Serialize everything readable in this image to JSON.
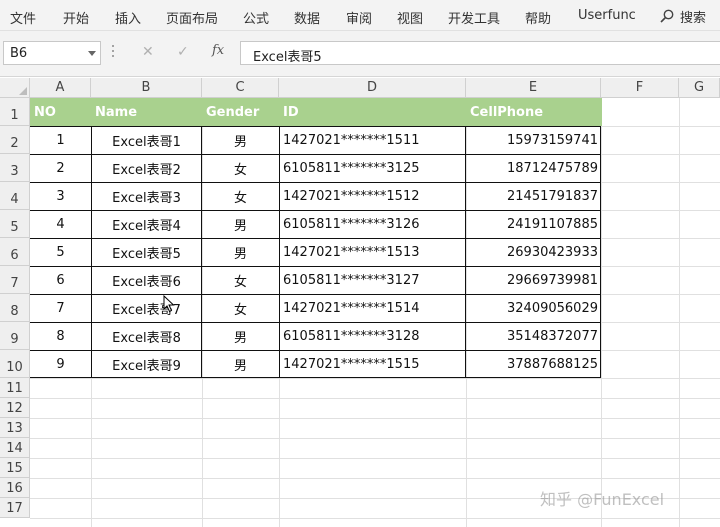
{
  "ribbon": {
    "tabs": [
      "文件",
      "开始",
      "插入",
      "页面布局",
      "公式",
      "数据",
      "审阅",
      "视图",
      "开发工具",
      "帮助",
      "Userfunc"
    ],
    "search_label": "搜索"
  },
  "formula_bar": {
    "name_box": "B6",
    "cancel_glyph": "✕",
    "enter_glyph": "✓",
    "fx_label": "fx",
    "content": "Excel表哥5"
  },
  "sheet": {
    "columns": [
      "A",
      "B",
      "C",
      "D",
      "E",
      "F",
      "G"
    ],
    "rows": [
      "1",
      "2",
      "3",
      "4",
      "5",
      "6",
      "7",
      "8",
      "9",
      "10",
      "11",
      "12",
      "13",
      "14",
      "15",
      "16",
      "17"
    ],
    "header": [
      "NO",
      "Name",
      "Gender",
      "ID",
      "CellPhone"
    ],
    "data": [
      [
        "1",
        "Excel表哥1",
        "男",
        "1427021*******1511",
        "15973159741"
      ],
      [
        "2",
        "Excel表哥2",
        "女",
        "6105811*******3125",
        "18712475789"
      ],
      [
        "3",
        "Excel表哥3",
        "女",
        "1427021*******1512",
        "21451791837"
      ],
      [
        "4",
        "Excel表哥4",
        "男",
        "6105811*******3126",
        "24191107885"
      ],
      [
        "5",
        "Excel表哥5",
        "男",
        "1427021*******1513",
        "26930423933"
      ],
      [
        "6",
        "Excel表哥6",
        "女",
        "6105811*******3127",
        "29669739981"
      ],
      [
        "7",
        "Excel表哥7",
        "女",
        "1427021*******1514",
        "32409056029"
      ],
      [
        "8",
        "Excel表哥8",
        "男",
        "6105811*******3128",
        "35148372077"
      ],
      [
        "9",
        "Excel表哥9",
        "男",
        "1427021*******1515",
        "37887688125"
      ]
    ]
  },
  "watermark": "知乎 @FunExcel",
  "colors": {
    "header_fill": "#a9d18e",
    "header_text": "#ffffff",
    "border": "#111111"
  }
}
